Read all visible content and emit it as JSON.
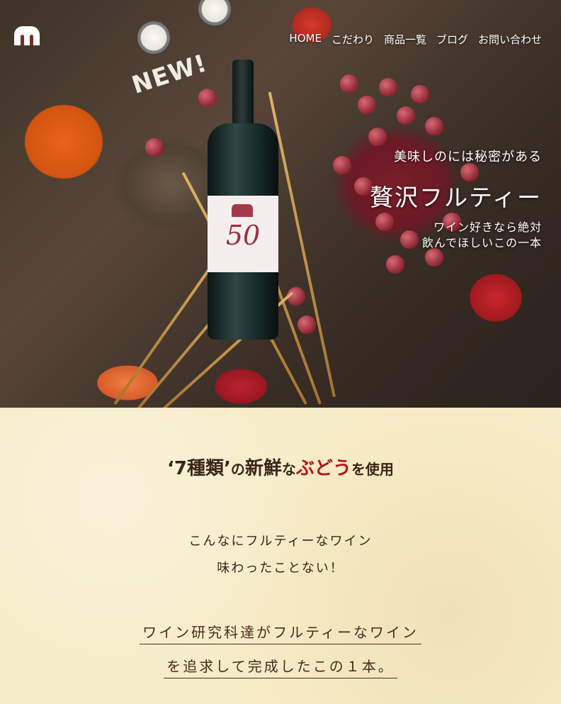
{
  "nav": {
    "logo_text": "m",
    "items": [
      "HOME",
      "こだわり",
      "商品一覧",
      "ブログ",
      "お問い合わせ"
    ]
  },
  "hero": {
    "new_tag": "NEW!",
    "bottle_number": "50",
    "tagline": "美味しのには秘密がある",
    "title": "贅沢フルティー",
    "subtitle_line1": "ワイン好きなら絶対",
    "subtitle_line2": "飲んでほしいこの一本"
  },
  "section": {
    "heading_part1": "‘7種類’",
    "heading_part2": "の",
    "heading_part3": "新鮮",
    "heading_part4": "な",
    "heading_part5": "ぶどう",
    "heading_part6": "を使用",
    "para_line1": "こんなにフルティーなワイン",
    "para_line2": "味わったことない！",
    "para2_line1": "ワイン研究科達がフルティーなワイン",
    "para2_line2": "を追求して完成したこの１本。"
  },
  "colors": {
    "accent_red": "#b31a1a",
    "text_dark": "#3a2419",
    "background_cream": "#f6ecc7"
  }
}
